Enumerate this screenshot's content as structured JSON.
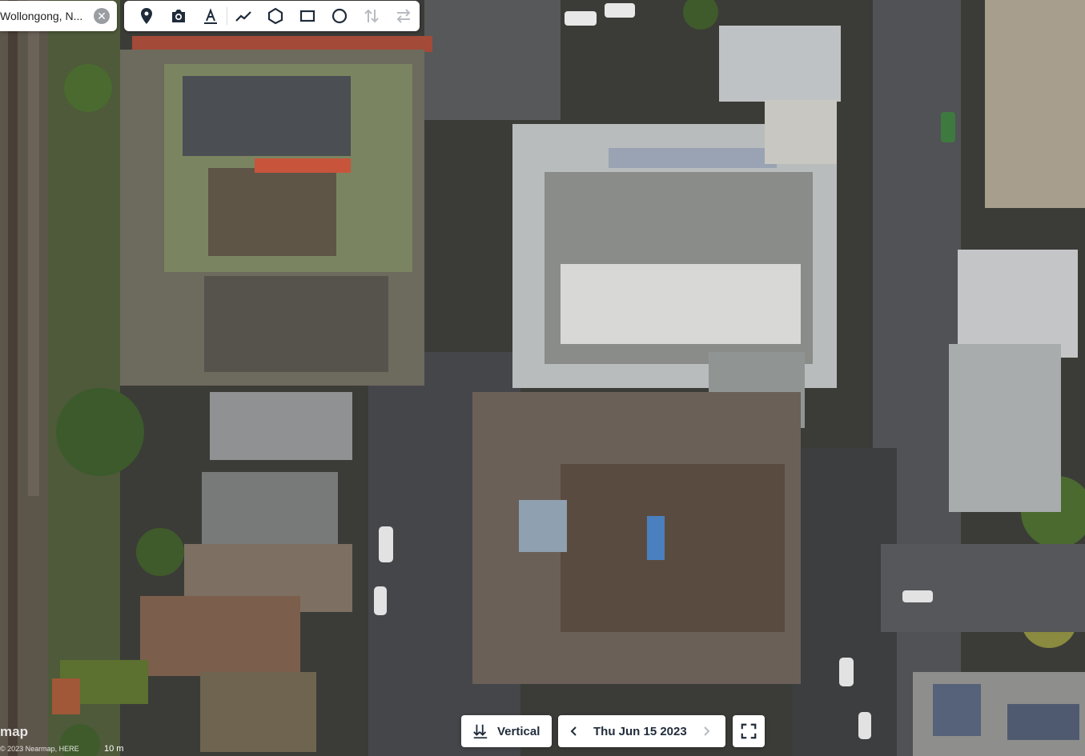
{
  "search": {
    "value": "Wollongong, N..."
  },
  "toolbar": {
    "tools": [
      "pin-icon",
      "camera-icon",
      "text-icon",
      "line-icon",
      "polygon-icon",
      "rectangle-icon",
      "circle-icon",
      "vertical-arrows-icon",
      "horizontal-arrows-icon"
    ]
  },
  "view_mode": {
    "label": "Vertical"
  },
  "date": {
    "label": "Thu Jun 15 2023"
  },
  "attribution": {
    "logo": "map",
    "text": "© 2023 Nearmap, HERE"
  },
  "scale": {
    "label": "10 m"
  },
  "colors": {
    "accent": "#1f2b3a",
    "disabled": "#b7bcc2"
  }
}
